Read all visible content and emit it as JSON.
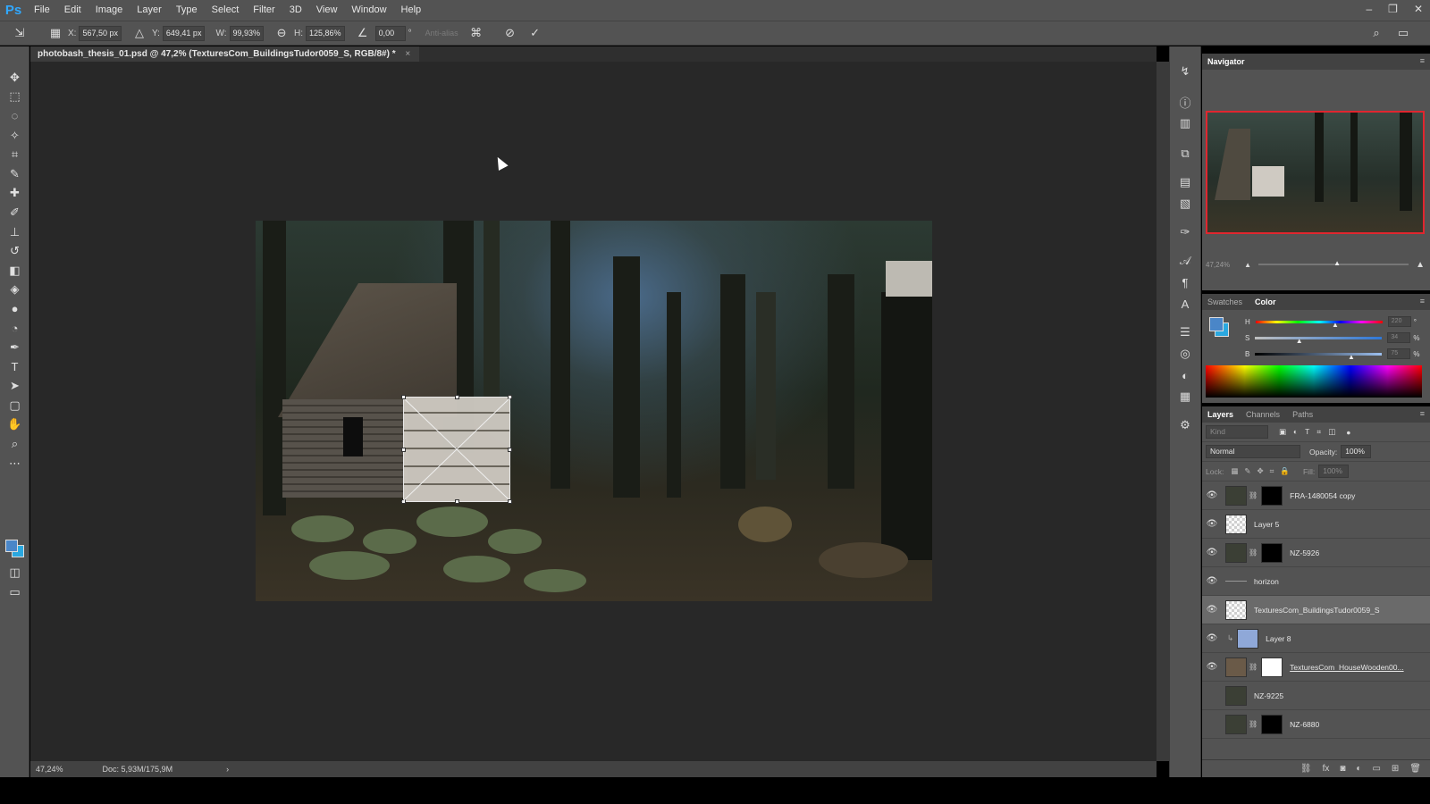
{
  "app": {
    "logo": "Ps"
  },
  "menu": [
    "File",
    "Edit",
    "Image",
    "Layer",
    "Type",
    "Select",
    "Filter",
    "3D",
    "View",
    "Window",
    "Help"
  ],
  "window_controls": {
    "minimize": "–",
    "restore": "❐",
    "close": "✕"
  },
  "options_bar": {
    "x_label": "X:",
    "x_value": "567,50 px",
    "y_label": "Y:",
    "y_value": "649,41 px",
    "w_label": "W:",
    "w_value": "99,93%",
    "h_label": "H:",
    "h_value": "125,86%",
    "angle_value": "0,00",
    "angle_unit": "°",
    "antialias": "Anti-alias"
  },
  "document": {
    "tab_title": "photobash_thesis_01.psd @ 47,2% (TexturesCom_BuildingsTudor0059_S, RGB/8#) *",
    "tab_close": "×",
    "zoom": "47,24%",
    "doc_size": "Doc: 5,93M/175,9M",
    "status_arrow": "›"
  },
  "navigator": {
    "title": "Navigator",
    "zoom": "47,24%"
  },
  "color_panel": {
    "tabs": [
      "Swatches",
      "Color"
    ],
    "active_tab": "Color",
    "h_label": "H",
    "h_value": "220",
    "h_unit": "°",
    "s_label": "S",
    "s_value": "34",
    "s_unit": "%",
    "b_label": "B",
    "b_value": "75",
    "b_unit": "%",
    "foreground": "#4a86c8",
    "background": "#2aa8e0"
  },
  "layers_panel": {
    "tabs": [
      "Layers",
      "Channels",
      "Paths"
    ],
    "active_tab": "Layers",
    "kind_placeholder": "Kind",
    "blend_mode": "Normal",
    "opacity_label": "Opacity:",
    "opacity_value": "100%",
    "lock_label": "Lock:",
    "fill_label": "Fill:",
    "fill_value": "100%",
    "layers": [
      {
        "name": "FRA-1480054 copy",
        "visible": true
      },
      {
        "name": "Layer 5",
        "visible": true
      },
      {
        "name": "NZ-5926",
        "visible": true
      },
      {
        "name": "horizon",
        "visible": true
      },
      {
        "name": "TexturesCom_BuildingsTudor0059_S",
        "visible": true,
        "selected": true
      },
      {
        "name": "Layer 8",
        "visible": true
      },
      {
        "name": "TexturesCom_HouseWooden00...",
        "visible": true
      },
      {
        "name": "NZ-9225",
        "visible": false
      },
      {
        "name": "NZ-6880",
        "visible": false
      }
    ]
  }
}
